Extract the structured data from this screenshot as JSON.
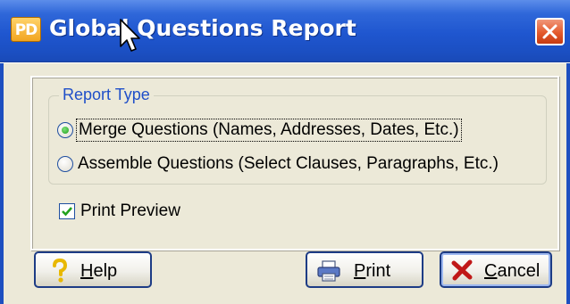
{
  "window": {
    "title": "Global Questions Report",
    "app_icon_text": "PD"
  },
  "report_type": {
    "legend": "Report Type",
    "options": [
      {
        "label": "Merge Questions (Names, Addresses, Dates, Etc.)",
        "selected": true
      },
      {
        "label": "Assemble Questions (Select Clauses, Paragraphs, Etc.)",
        "selected": false
      }
    ]
  },
  "print_preview": {
    "label": "Print Preview",
    "checked": true
  },
  "buttons": {
    "help": {
      "label": "Help",
      "mnemonic": "H"
    },
    "print": {
      "label": "Print",
      "mnemonic": "P"
    },
    "cancel": {
      "label": "Cancel",
      "mnemonic": "C"
    }
  },
  "colors": {
    "titlebar": "#1f56cf",
    "dialog_face": "#ece9d8",
    "legend_text": "#1f4fc9",
    "close_button": "#e45a2c"
  }
}
